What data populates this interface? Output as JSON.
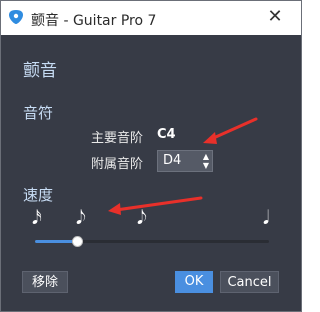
{
  "window": {
    "title": "颤音 - Guitar Pro 7",
    "app_icon": "guitar-pick-icon",
    "close_glyph": "✕"
  },
  "heading": "颤音",
  "pitch_section": {
    "label": "音符",
    "main_label": "主要音阶",
    "main_value": "C4",
    "aux_label": "附属音阶",
    "aux_value": "D4"
  },
  "speed_section": {
    "label": "速度",
    "notes": [
      "𝅘𝅥𝅯",
      "𝅘𝅥𝅮",
      "𝅘𝅥𝅮",
      "𝅘𝅥"
    ],
    "slider_value_fraction": 0.18
  },
  "buttons": {
    "remove": "移除",
    "ok": "OK",
    "cancel": "Cancel"
  },
  "annotations": {
    "arrow_color": "#e8302a"
  },
  "colors": {
    "background": "#373b46",
    "accent": "#4a8fe0",
    "heading_text": "#c7dcf4"
  }
}
